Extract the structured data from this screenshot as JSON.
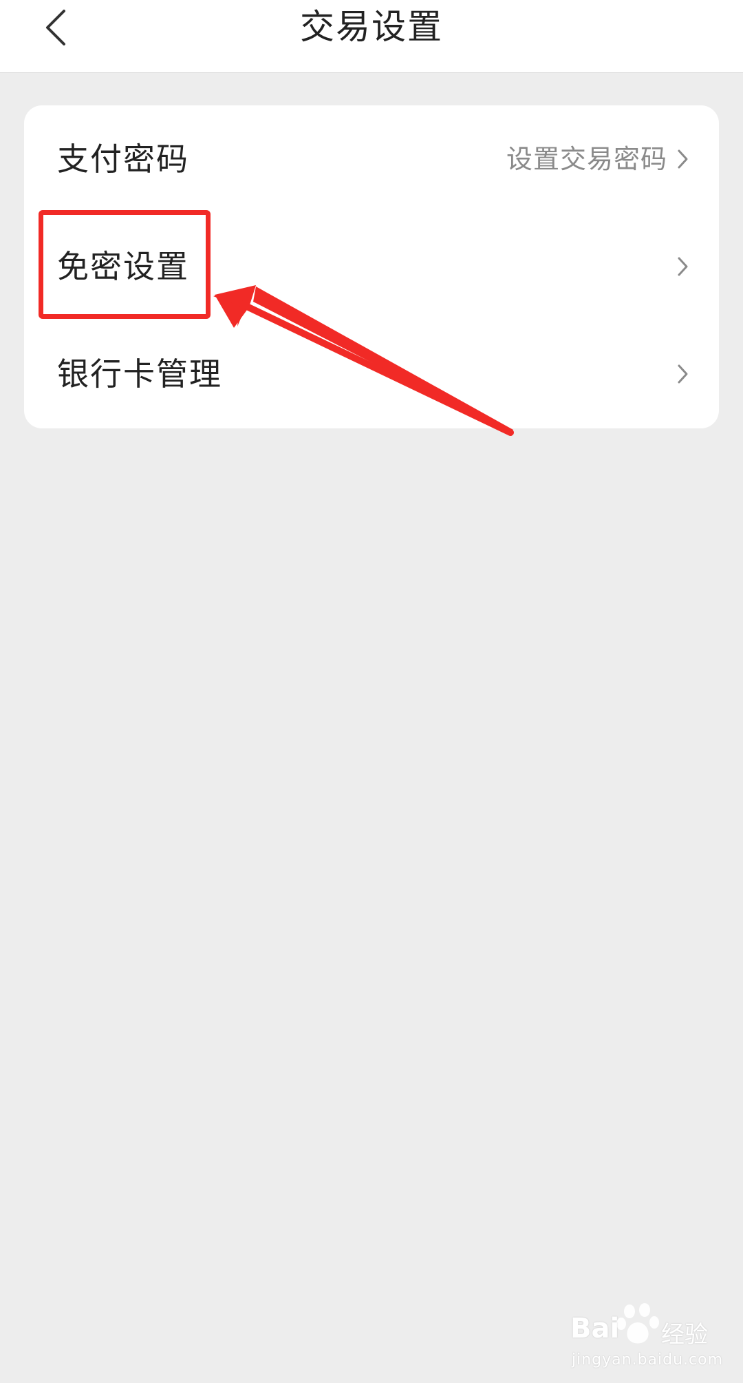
{
  "header": {
    "title": "交易设置",
    "back_icon": "chevron-left-icon"
  },
  "settings": {
    "items": [
      {
        "label": "支付密码",
        "value": "设置交易密码",
        "icon": "chevron-right-icon"
      },
      {
        "label": "免密设置",
        "value": "",
        "icon": "chevron-right-icon"
      },
      {
        "label": "银行卡管理",
        "value": "",
        "icon": "chevron-right-icon"
      }
    ]
  },
  "annotation": {
    "color": "#f12a26"
  },
  "watermark": {
    "brand_prefix": "Bai",
    "brand_suffix": "经验",
    "url": "jingyan.baidu.com"
  },
  "colors": {
    "background": "#ededed",
    "card": "#ffffff",
    "text_primary": "#222222",
    "text_secondary": "#8a8a8a",
    "annotation_red": "#f12a26"
  }
}
